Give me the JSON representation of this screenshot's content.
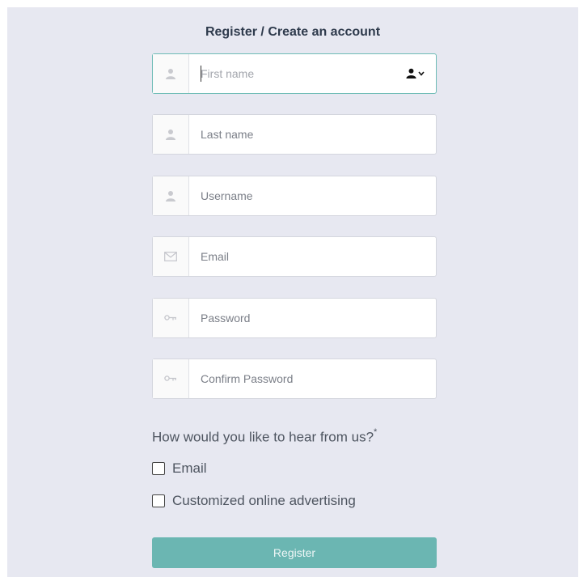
{
  "form": {
    "title": "Register / Create an account",
    "fields": [
      {
        "placeholder": "First name",
        "icon": "user-icon"
      },
      {
        "placeholder": "Last name",
        "icon": "user-icon"
      },
      {
        "placeholder": "Username",
        "icon": "user-icon"
      },
      {
        "placeholder": "Email",
        "icon": "envelope-icon"
      },
      {
        "placeholder": "Password",
        "icon": "key-icon"
      },
      {
        "placeholder": "Confirm Password",
        "icon": "key-icon"
      }
    ],
    "question": "How would you like to hear from us?",
    "required_mark": "*",
    "options": [
      {
        "label": "Email",
        "checked": false
      },
      {
        "label": "Customized online advertising",
        "checked": false
      }
    ],
    "submit_label": "Register"
  },
  "colors": {
    "background": "#e7e8f1",
    "accent": "#6bb6b2",
    "focus_border": "#6ebcb6",
    "title_text": "#2e3a4c"
  }
}
